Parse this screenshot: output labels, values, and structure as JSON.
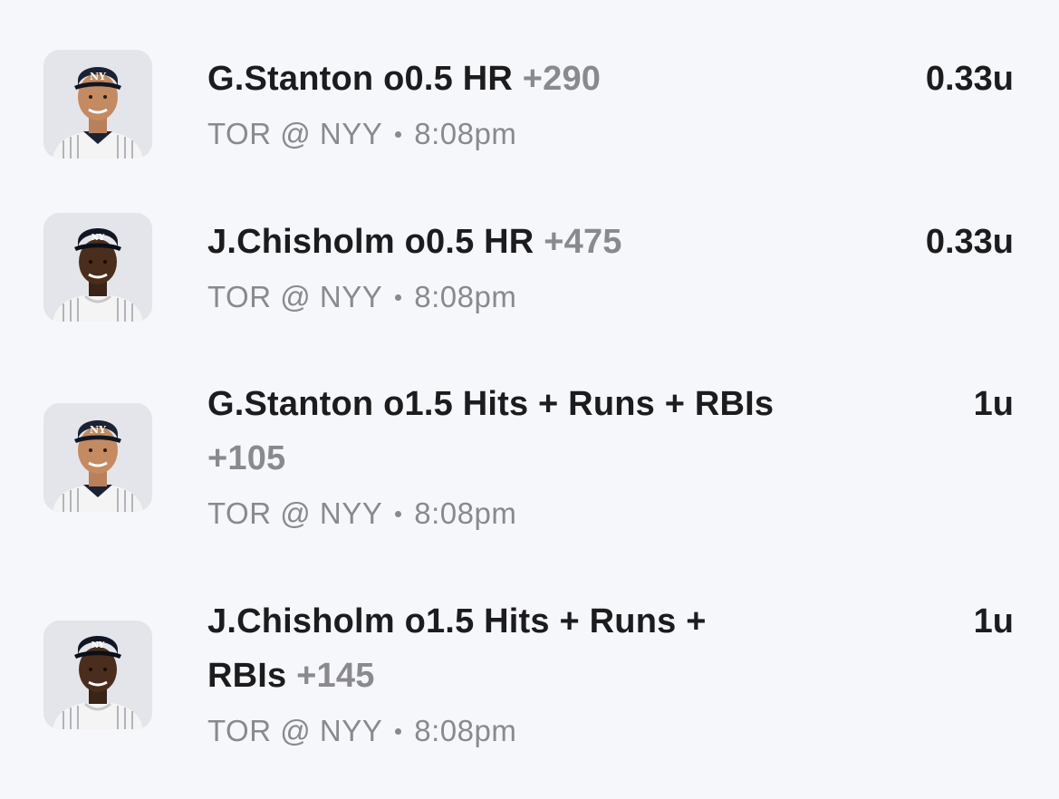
{
  "bets": [
    {
      "player": "G.Stanton",
      "prop": "o0.5 HR",
      "odds": "+290",
      "line1": "G.Stanton o0.5 HR",
      "line2": "",
      "matchup": "TOR @ NYY",
      "time": "8:08pm",
      "units": "0.33u",
      "avatar": "stanton-headshot"
    },
    {
      "player": "J.Chisholm",
      "prop": "o0.5 HR",
      "odds": "+475",
      "line1": "J.Chisholm o0.5 HR",
      "line2": "",
      "matchup": "TOR @ NYY",
      "time": "8:08pm",
      "units": "0.33u",
      "avatar": "chisholm-headshot"
    },
    {
      "player": "G.Stanton",
      "prop": "o1.5 Hits + Runs + RBIs",
      "odds": "+105",
      "line1": "G.Stanton o1.5 Hits + Runs + RBIs",
      "line2": "",
      "matchup": "TOR @ NYY",
      "time": "8:08pm",
      "units": "1u",
      "avatar": "stanton-headshot"
    },
    {
      "player": "J.Chisholm",
      "prop": "o1.5 Hits + Runs + RBIs",
      "odds": "+145",
      "line1": "J.Chisholm o1.5 Hits + Runs +",
      "line2": "RBIs",
      "matchup": "TOR @ NYY",
      "time": "8:08pm",
      "units": "1u",
      "avatar": "chisholm-headshot"
    }
  ],
  "colors": {
    "background": "#f6f7fb",
    "primary_text": "#1c1c1e",
    "secondary_text": "#8a8a8e",
    "avatar_bg": "#e4e5ea",
    "cap": "#1b2233",
    "jersey_stripe": "#2a3350"
  }
}
